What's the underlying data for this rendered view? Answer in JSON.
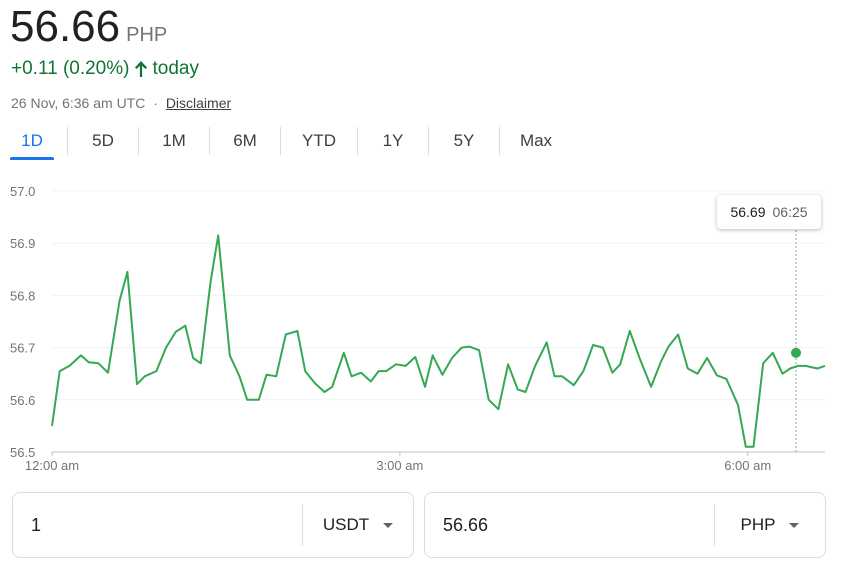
{
  "header": {
    "price": "56.66",
    "currency": "PHP",
    "change": "+0.11 (0.20%)",
    "change_suffix": "today",
    "timestamp": "26 Nov, 6:36 am UTC",
    "separator": "·",
    "disclaimer": "Disclaimer",
    "positive_color": "#137333"
  },
  "tabs": [
    {
      "label": "1D",
      "active": true
    },
    {
      "label": "5D"
    },
    {
      "label": "1M"
    },
    {
      "label": "6M"
    },
    {
      "label": "YTD"
    },
    {
      "label": "1Y"
    },
    {
      "label": "5Y"
    },
    {
      "label": "Max"
    }
  ],
  "tooltip": {
    "value": "56.69",
    "time": "06:25"
  },
  "converter": {
    "from_value": "1",
    "from_unit": "USDT",
    "to_value": "56.66",
    "to_unit": "PHP"
  },
  "chart_data": {
    "type": "line",
    "line_color": "#34a853",
    "ylim": [
      56.5,
      57.0
    ],
    "yticks": [
      "57.0",
      "56.9",
      "56.8",
      "56.7",
      "56.6",
      "56.5"
    ],
    "yticks_values": [
      57.0,
      56.9,
      56.8,
      56.7,
      56.6,
      56.5
    ],
    "xticks": [
      "12:00 am",
      "3:00 am",
      "6:00 am"
    ],
    "xticks_values": [
      0,
      180,
      360
    ],
    "xlim": [
      0,
      400
    ],
    "grid": true,
    "marker": {
      "x": 385,
      "y": 56.69
    },
    "series": [
      {
        "x": [
          0,
          4,
          9,
          15,
          19,
          24,
          29,
          35,
          39,
          44,
          48,
          54,
          59,
          64,
          69,
          73,
          77,
          82,
          86,
          92,
          97,
          101,
          107,
          111,
          116,
          121,
          127,
          131,
          136,
          141,
          145,
          151,
          155,
          160,
          165,
          169,
          173,
          178,
          183,
          188,
          193,
          197,
          202,
          207,
          212,
          216,
          221,
          226,
          231,
          236,
          241,
          245,
          250,
          256,
          260,
          264,
          270,
          275,
          280,
          285,
          290,
          294,
          299,
          304,
          310,
          315,
          319,
          324,
          329,
          334,
          339,
          344,
          349,
          355,
          359,
          363,
          368,
          373,
          378,
          382,
          386,
          390,
          396,
          400
        ],
        "y": [
          56.55,
          56.655,
          56.665,
          56.685,
          56.672,
          56.67,
          56.652,
          56.79,
          56.845,
          56.63,
          56.645,
          56.655,
          56.7,
          56.73,
          56.742,
          56.68,
          56.67,
          56.825,
          56.915,
          56.685,
          56.645,
          56.6,
          56.6,
          56.648,
          56.645,
          56.725,
          56.732,
          56.655,
          56.632,
          56.615,
          56.625,
          56.69,
          56.645,
          56.652,
          56.635,
          56.655,
          56.655,
          56.668,
          56.665,
          56.682,
          56.625,
          56.685,
          56.648,
          56.68,
          56.7,
          56.702,
          56.695,
          56.6,
          56.582,
          56.668,
          56.62,
          56.615,
          56.665,
          56.71,
          56.645,
          56.645,
          56.628,
          56.655,
          56.705,
          56.7,
          56.652,
          56.668,
          56.732,
          56.68,
          56.625,
          56.672,
          56.702,
          56.725,
          56.66,
          56.65,
          56.68,
          56.647,
          56.64,
          56.59,
          56.51,
          56.51,
          56.67,
          56.69,
          56.65,
          56.66,
          56.665,
          56.665,
          56.66,
          56.665
        ]
      }
    ]
  }
}
